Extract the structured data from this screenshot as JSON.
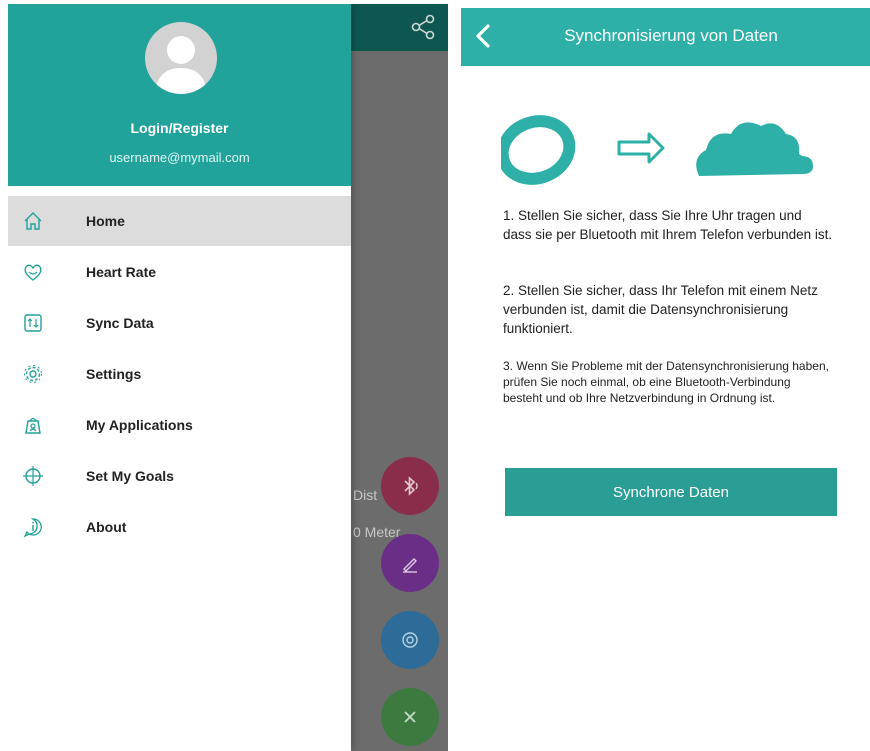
{
  "left_screen": {
    "background": {
      "distance_label": "Dist",
      "meter_label": "0 Meter"
    },
    "drawer": {
      "login_label": "Login/Register",
      "email": "username@mymail.com",
      "items": [
        {
          "label": "Home",
          "icon": "home-icon",
          "active": true
        },
        {
          "label": "Heart Rate",
          "icon": "heart-rate-icon"
        },
        {
          "label": "Sync Data",
          "icon": "sync-icon"
        },
        {
          "label": "Settings",
          "icon": "gear-icon"
        },
        {
          "label": "My Applications",
          "icon": "applications-icon"
        },
        {
          "label": "Set My Goals",
          "icon": "target-icon"
        },
        {
          "label": "About",
          "icon": "info-icon"
        }
      ]
    },
    "colors": {
      "accent": "#21a29a",
      "fab_bluetooth": "#e91e63",
      "fab_edit": "#9c27b0",
      "fab_target": "#2196f3",
      "fab_close": "#4caf50"
    }
  },
  "right_screen": {
    "title": "Synchronisierung von Daten",
    "steps": [
      "1. Stellen Sie sicher, dass Sie Ihre Uhr tragen und dass sie per Bluetooth mit Ihrem Telefon verbunden ist.",
      "2. Stellen Sie sicher, dass Ihr Telefon mit einem Netz verbunden ist, damit die Datensynchronisierung funktioniert.",
      "3. Wenn Sie Probleme mit der Datensynchronisierung haben, prüfen Sie noch einmal, ob eine Bluetooth-Verbindung besteht und ob Ihre Netzverbindung in Ordnung ist."
    ],
    "sync_button_label": "Synchrone Daten",
    "colors": {
      "header": "#2eb0a8",
      "button": "#2a9d95"
    }
  }
}
